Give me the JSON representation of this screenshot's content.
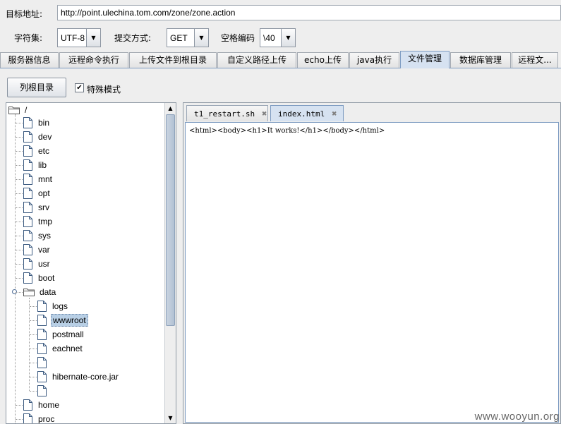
{
  "target": {
    "label": "目标地址:",
    "url": "http://point.ulechina.tom.com/zone/zone.action"
  },
  "options": {
    "charset_label": "字符集:",
    "charset": "UTF-8",
    "method_label": "提交方式:",
    "method": "GET",
    "space_label": "空格编码",
    "space": "\\40"
  },
  "tabs": [
    "服务器信息",
    "远程命令执行",
    "上传文件到根目录",
    "自定义路径上传",
    "echo上传",
    "java执行",
    "文件管理",
    "数据库管理",
    "远程文..."
  ],
  "active_tab": "文件管理",
  "toolbar": {
    "list_root": "列根目录",
    "special_mode": "特殊模式",
    "special_checked": true
  },
  "tree": {
    "root": "/",
    "items": [
      "bin",
      "dev",
      "etc",
      "lib",
      "mnt",
      "opt",
      "srv",
      "tmp",
      "sys",
      "var",
      "usr",
      "boot"
    ],
    "data_folder": "data",
    "data_children": [
      "logs",
      "wwwroot",
      "postmall",
      "eachnet",
      "",
      "hibernate-core.jar",
      ""
    ],
    "after": [
      "home",
      "proc"
    ],
    "selected": "wwwroot"
  },
  "editor": {
    "tabs": [
      "t1_restart.sh",
      "index.html"
    ],
    "active_tab": "index.html",
    "content": "<html><body><h1>It works!</h1></body></html>"
  },
  "watermark": "www.wooyun.org",
  "icons": [
    "file-icon",
    "folder-icon",
    "close-icon",
    "chevron-down-icon"
  ]
}
